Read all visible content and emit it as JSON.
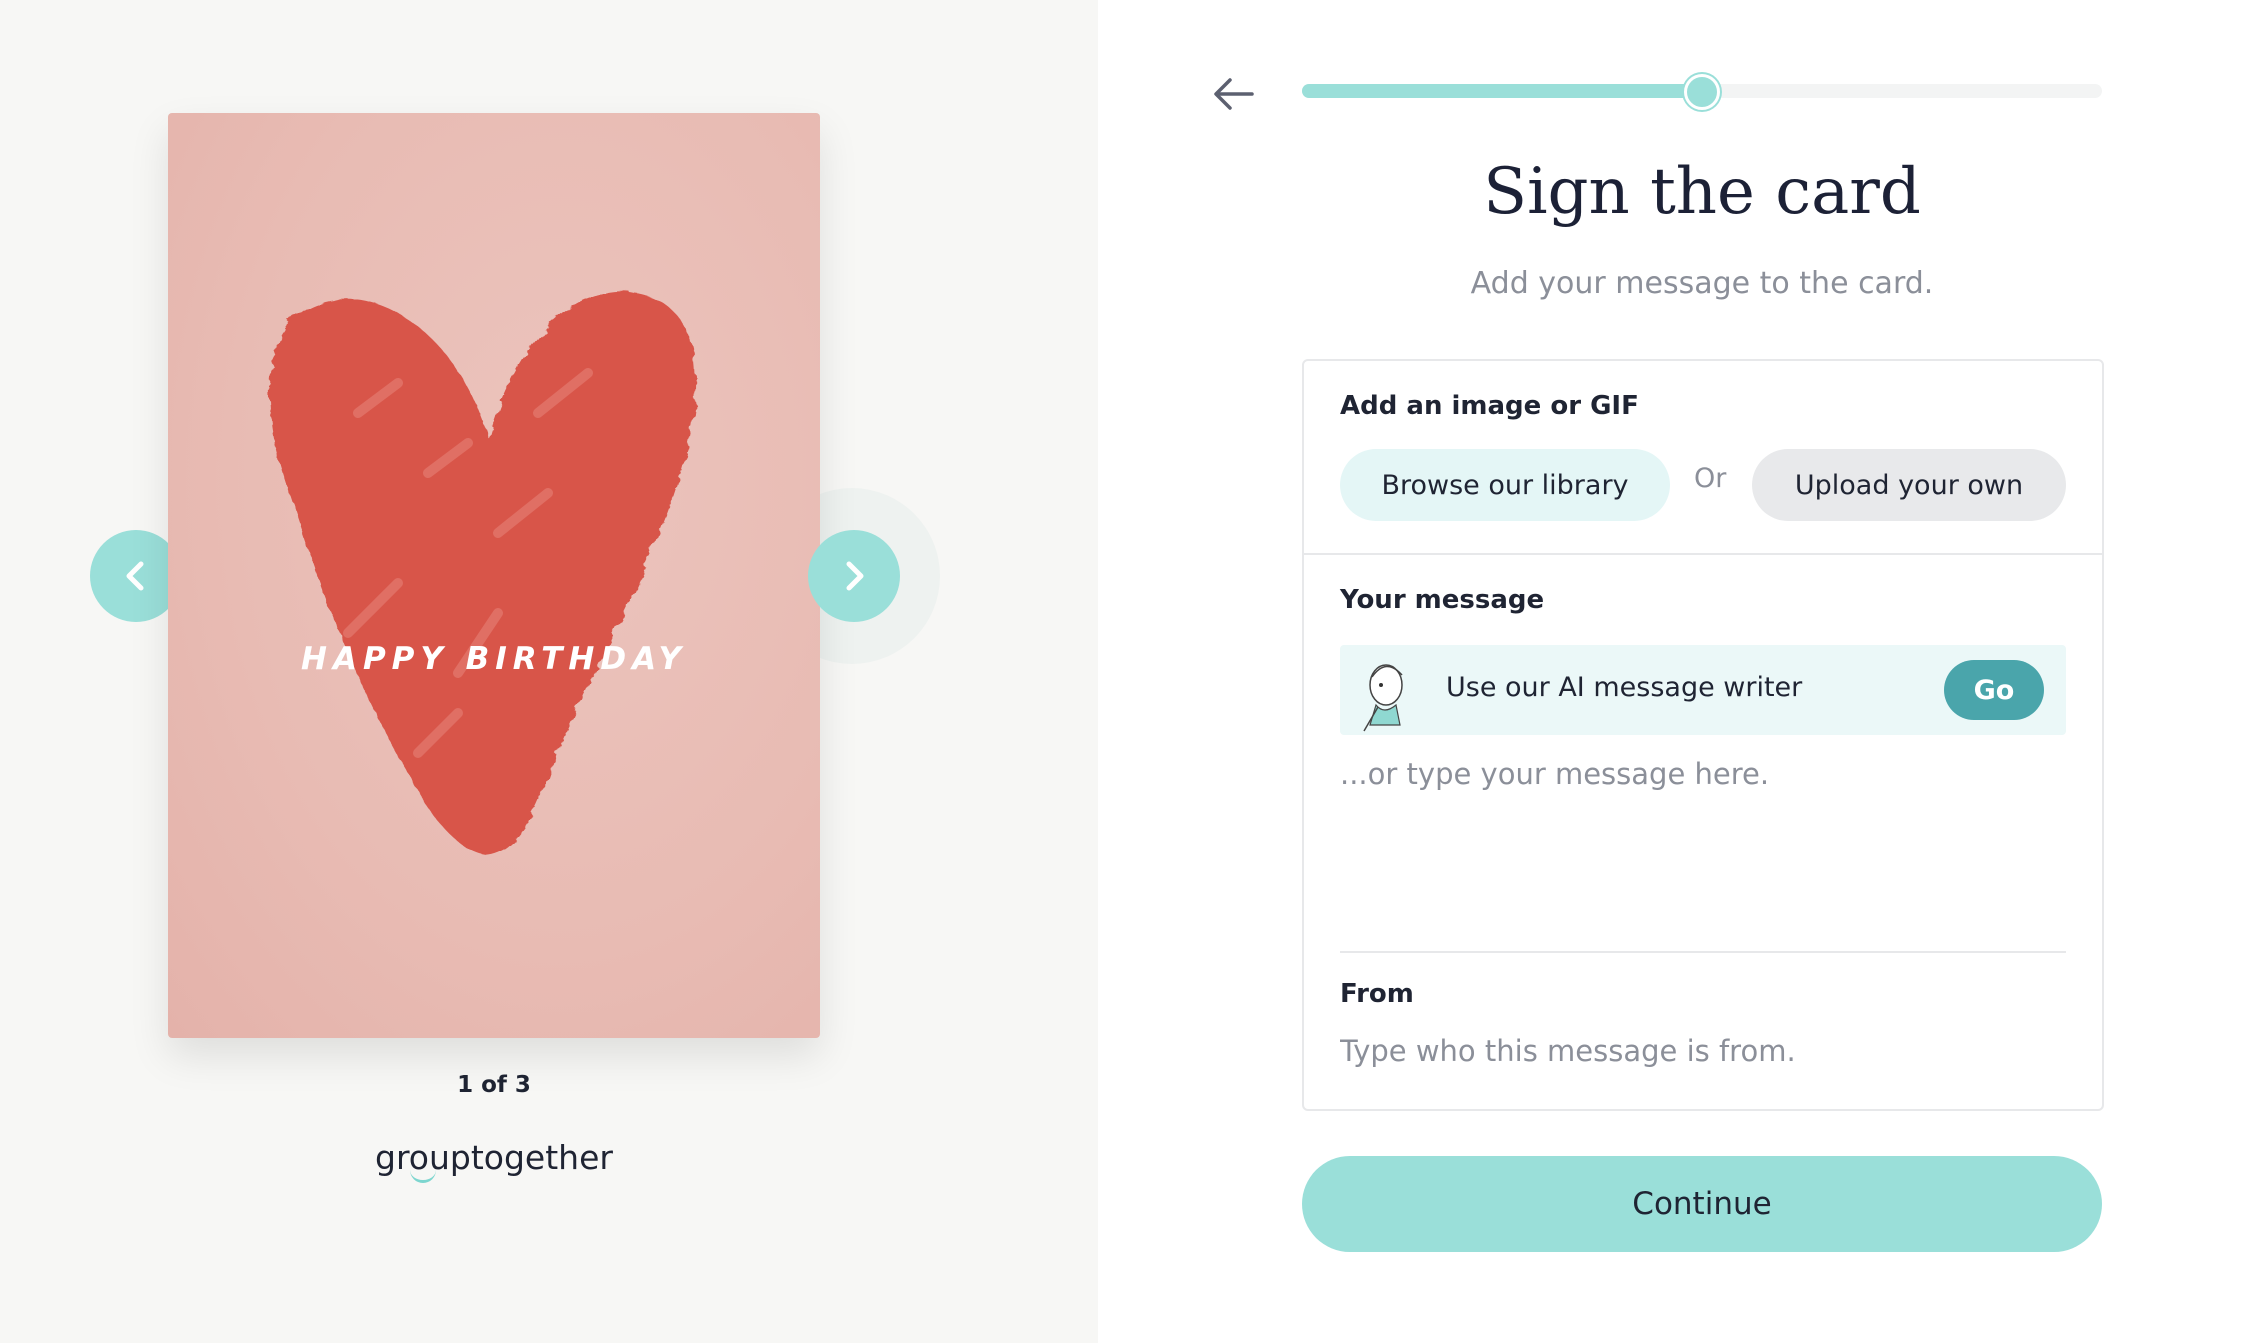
{
  "card": {
    "greeting": "HAPPY BIRTHDAY",
    "page_indicator": "1 of 3",
    "prev_icon": "chevron-left-icon",
    "next_icon": "chevron-right-icon"
  },
  "brand": {
    "logo_text": "grouptogether"
  },
  "progress": {
    "fraction": 0.5
  },
  "header": {
    "title": "Sign the card",
    "subtitle": "Add your message to the card."
  },
  "image_section": {
    "label": "Add an image or GIF",
    "browse_label": "Browse our library",
    "or_label": "Or",
    "upload_label": "Upload your own"
  },
  "message_section": {
    "label": "Your message",
    "ai_label": "Use our AI message writer",
    "go_label": "Go",
    "placeholder": "...or type your message here."
  },
  "from_section": {
    "label": "From",
    "placeholder": "Type who this message is from."
  },
  "continue_label": "Continue",
  "colors": {
    "accent": "#9adfd9",
    "go_button": "#4aa5ab",
    "card_pink": "#e8bbb3",
    "heart_red": "#d8554a"
  }
}
